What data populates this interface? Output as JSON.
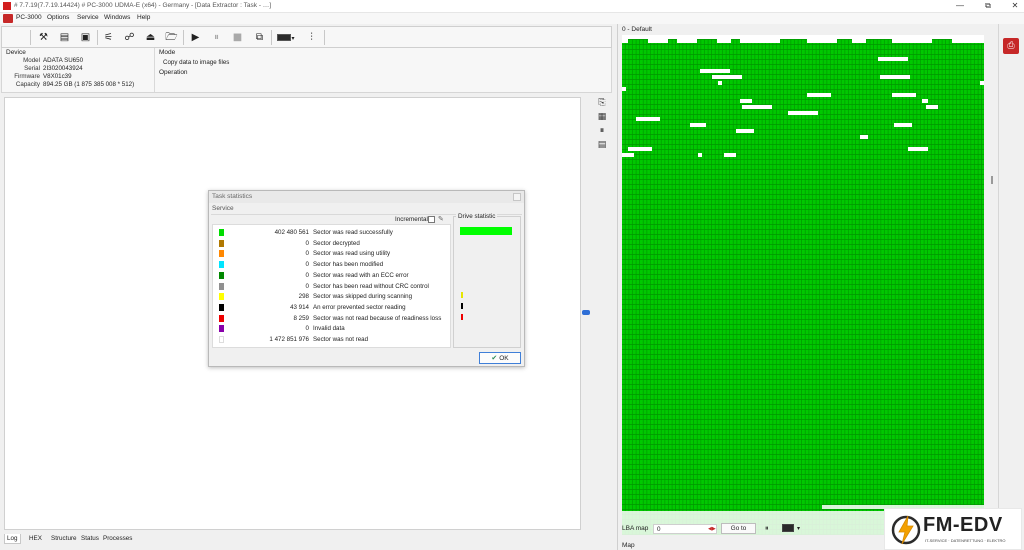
{
  "titlebar": {
    "title": "# 7.7.19(7.7.19.14424) # PC-3000 UDMA-E (x64) - Germany - [Data Extractor : Task - …]",
    "minimize": "—",
    "restore": "⧉",
    "close": "✕"
  },
  "menu": {
    "app_name": "PC-3000",
    "items": [
      "Options",
      "Service",
      "Windows",
      "Help"
    ]
  },
  "toolbar": {
    "buttons": [
      "tools-icon",
      "task-icon",
      "task-save-icon",
      "sector-map-icon",
      "binoculars-icon",
      "hdd-icon",
      "folder-open-icon",
      "play-icon",
      "pause-icon",
      "stop-icon",
      "copy-icon",
      "drive-selector-icon",
      "drive-settings-icon"
    ]
  },
  "device": {
    "header": "Device",
    "model_label": "Model",
    "model": "ADATA SU650",
    "serial_label": "Serial",
    "serial": "2I3020043924",
    "firmware_label": "Firmware",
    "firmware": "V8X01c39",
    "capacity_label": "Capacity",
    "capacity": "894.25 GB (1 875 385 008 * 512)",
    "mode_header": "Mode",
    "mode": "Copy data to image files",
    "operation_header": "Operation"
  },
  "bottom_tabs": [
    "Log",
    "HEX",
    "Structure",
    "Status",
    "Processes"
  ],
  "dialog": {
    "title": "Task statistics",
    "service": "Service",
    "incremental_label": "Incremental",
    "drive_statistic_label": "Drive statistic",
    "ok_label": "OK",
    "rows": [
      {
        "color": "#00dd00",
        "count": "402 480 561",
        "desc": "Sector was read successfully"
      },
      {
        "color": "#b07800",
        "count": "0",
        "desc": "Sector decrypted"
      },
      {
        "color": "#ff8800",
        "count": "0",
        "desc": "Sector was read using utility"
      },
      {
        "color": "#00e5ff",
        "count": "0",
        "desc": "Sector has been modified"
      },
      {
        "color": "#008800",
        "count": "0",
        "desc": "Sector was read with an ECC error"
      },
      {
        "color": "#909090",
        "count": "0",
        "desc": "Sector has been read without CRC control"
      },
      {
        "color": "#ffff00",
        "count": "298",
        "desc": "Sector was skipped during scanning"
      },
      {
        "color": "#000000",
        "count": "43 914",
        "desc": "An error prevented sector reading"
      },
      {
        "color": "#ee0000",
        "count": "8 259",
        "desc": "Sector was not read because of readiness loss"
      },
      {
        "color": "#8800aa",
        "count": "0",
        "desc": "Invalid data"
      },
      {
        "color": "#ffffff",
        "count": "1 472 851 976",
        "desc": "Sector was not read"
      }
    ]
  },
  "map": {
    "title": "0 - Default",
    "lba_label": "LBA map",
    "lba_value": "0",
    "goto_label": "Go to",
    "map_tab": "Map",
    "read_color": "#00c800",
    "unread_color": "#ffffff"
  },
  "logo": {
    "name": "FM-EDV",
    "tagline": "IT-SERVICE · DATENRETTUNG · ELEKTRO"
  }
}
